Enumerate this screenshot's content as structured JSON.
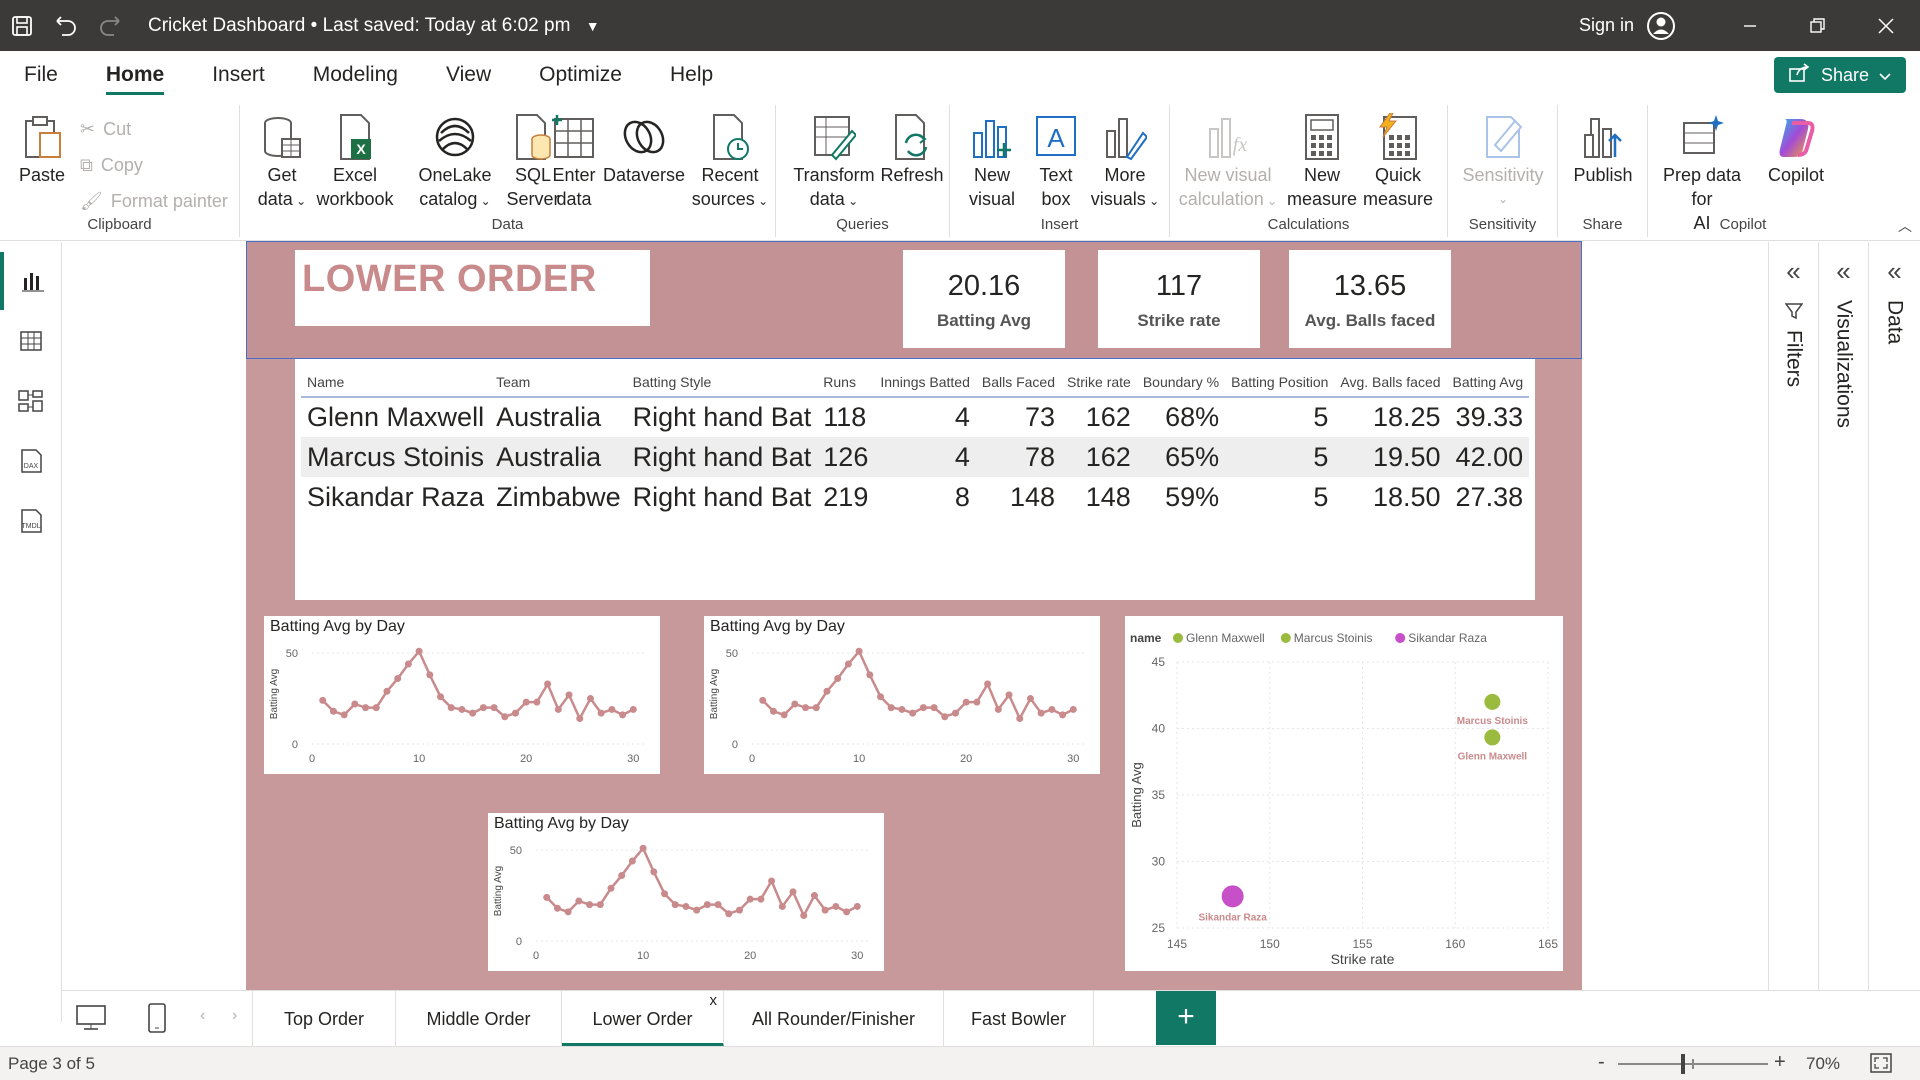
{
  "titlebar": {
    "title": "Cricket Dashboard",
    "saved": "Last saved: Today at 6:02 pm",
    "signin": "Sign in"
  },
  "menu": {
    "tabs": [
      "File",
      "Home",
      "Insert",
      "Modeling",
      "View",
      "Optimize",
      "Help"
    ],
    "active": "Home",
    "share": "Share"
  },
  "ribbon": {
    "clipboard": {
      "label": "Clipboard",
      "paste": "Paste",
      "cut": "Cut",
      "copy": "Copy",
      "format_painter": "Format painter"
    },
    "data": {
      "label": "Data",
      "get_data": [
        "Get",
        "data"
      ],
      "excel": [
        "Excel",
        "workbook"
      ],
      "onelake": [
        "OneLake",
        "catalog"
      ],
      "sql": [
        "SQL",
        "Server"
      ],
      "enter": [
        "Enter",
        "data"
      ],
      "dataverse": "Dataverse",
      "recent": [
        "Recent",
        "sources"
      ]
    },
    "queries": {
      "label": "Queries",
      "transform": [
        "Transform",
        "data"
      ],
      "refresh": "Refresh"
    },
    "insert": {
      "label": "Insert",
      "new_visual": [
        "New",
        "visual"
      ],
      "text_box": [
        "Text",
        "box"
      ],
      "more_visuals": [
        "More",
        "visuals"
      ]
    },
    "calculations": {
      "label": "Calculations",
      "new_visual_calc": [
        "New visual",
        "calculation"
      ],
      "new_measure": [
        "New",
        "measure"
      ],
      "quick_measure": [
        "Quick",
        "measure"
      ]
    },
    "sensitivity": {
      "label": "Sensitivity",
      "btn": "Sensitivity"
    },
    "share": {
      "label": "Share",
      "publish": "Publish"
    },
    "copilot": {
      "label": "Copilot",
      "prep": [
        "Prep data for",
        "AI"
      ],
      "copilot": "Copilot"
    }
  },
  "report": {
    "title": "LOWER ORDER",
    "kpis": [
      {
        "value": "20.16",
        "label": "Batting Avg"
      },
      {
        "value": "117",
        "label": "Strike rate"
      },
      {
        "value": "13.65",
        "label": "Avg. Balls faced"
      }
    ],
    "table": {
      "columns": [
        "Name",
        "Team",
        "Batting Style",
        "Runs",
        "Innings Batted",
        "Balls Faced",
        "Strike rate",
        "Boundary %",
        "Batting Position",
        "Avg. Balls faced",
        "Batting Avg"
      ],
      "rows": [
        [
          "Glenn Maxwell",
          "Australia",
          "Right hand Bat",
          "118",
          "4",
          "73",
          "162",
          "68%",
          "5",
          "18.25",
          "39.33"
        ],
        [
          "Marcus Stoinis",
          "Australia",
          "Right hand Bat",
          "126",
          "4",
          "78",
          "162",
          "65%",
          "5",
          "19.50",
          "42.00"
        ],
        [
          "Sikandar Raza",
          "Zimbabwe",
          "Right hand Bat",
          "219",
          "8",
          "148",
          "148",
          "59%",
          "5",
          "18.50",
          "27.38"
        ]
      ]
    },
    "line_chart_title": "Batting Avg by Day",
    "line_chart_ylabel": "Batting Avg",
    "scatter_legend_title": "name",
    "scatter_xlabel": "Strike rate",
    "scatter_ylabel": "Batting Avg"
  },
  "chart_data": [
    {
      "type": "line",
      "title": "Batting Avg by Day",
      "xlabel": "",
      "ylabel": "Batting Avg",
      "xlim": [
        0,
        31
      ],
      "ylim": [
        0,
        55
      ],
      "xticks": [
        0,
        10,
        20,
        30
      ],
      "yticks": [
        0,
        50
      ],
      "color": "#c98a8c",
      "x": [
        1,
        2,
        3,
        4,
        5,
        6,
        7,
        8,
        9,
        10,
        11,
        12,
        13,
        14,
        15,
        16,
        17,
        18,
        19,
        20,
        21,
        22,
        23,
        24,
        25,
        26,
        27,
        28,
        29,
        30
      ],
      "y": [
        24,
        18,
        16,
        22,
        20,
        20,
        29,
        36,
        44,
        51,
        38,
        26,
        20,
        19,
        17,
        20,
        20,
        15,
        17,
        23,
        23,
        33,
        19,
        27,
        14,
        25,
        17,
        19,
        16,
        19
      ]
    },
    {
      "type": "line",
      "title": "Batting Avg by Day",
      "xlabel": "",
      "ylabel": "Batting Avg",
      "xlim": [
        0,
        31
      ],
      "ylim": [
        0,
        55
      ],
      "xticks": [
        0,
        10,
        20,
        30
      ],
      "yticks": [
        0,
        50
      ],
      "color": "#c98a8c",
      "x": [
        1,
        2,
        3,
        4,
        5,
        6,
        7,
        8,
        9,
        10,
        11,
        12,
        13,
        14,
        15,
        16,
        17,
        18,
        19,
        20,
        21,
        22,
        23,
        24,
        25,
        26,
        27,
        28,
        29,
        30
      ],
      "y": [
        24,
        18,
        16,
        22,
        20,
        20,
        29,
        36,
        44,
        51,
        38,
        26,
        20,
        19,
        17,
        20,
        20,
        15,
        17,
        23,
        23,
        33,
        19,
        27,
        14,
        25,
        17,
        19,
        16,
        19
      ]
    },
    {
      "type": "line",
      "title": "Batting Avg by Day",
      "xlabel": "",
      "ylabel": "Batting Avg",
      "xlim": [
        0,
        31
      ],
      "ylim": [
        0,
        55
      ],
      "xticks": [
        0,
        10,
        20,
        30
      ],
      "yticks": [
        0,
        50
      ],
      "color": "#c98a8c",
      "x": [
        1,
        2,
        3,
        4,
        5,
        6,
        7,
        8,
        9,
        10,
        11,
        12,
        13,
        14,
        15,
        16,
        17,
        18,
        19,
        20,
        21,
        22,
        23,
        24,
        25,
        26,
        27,
        28,
        29,
        30
      ],
      "y": [
        24,
        18,
        16,
        22,
        20,
        20,
        29,
        36,
        44,
        51,
        38,
        26,
        20,
        19,
        17,
        20,
        20,
        15,
        17,
        23,
        23,
        33,
        19,
        27,
        14,
        25,
        17,
        19,
        16,
        19
      ]
    },
    {
      "type": "scatter",
      "title": "",
      "xlabel": "Strike rate",
      "ylabel": "Batting Avg",
      "xlim": [
        145,
        165
      ],
      "ylim": [
        25,
        45
      ],
      "xticks": [
        145,
        150,
        155,
        160,
        165
      ],
      "yticks": [
        25,
        30,
        35,
        40,
        45
      ],
      "legend_title": "name",
      "legend_position": "top-left",
      "series": [
        {
          "name": "Glenn Maxwell",
          "color": "#9bbb3f",
          "x": [
            162
          ],
          "y": [
            39.33
          ]
        },
        {
          "name": "Marcus Stoinis",
          "color": "#9bbb3f",
          "x": [
            162
          ],
          "y": [
            42.0
          ]
        },
        {
          "name": "Sikandar Raza",
          "color": "#c74fc7",
          "x": [
            148
          ],
          "y": [
            27.38
          ]
        }
      ]
    }
  ],
  "pane": {
    "filters": "Filters",
    "visualizations": "Visualizations",
    "data": "Data"
  },
  "pages": {
    "tabs": [
      "Top Order",
      "Middle Order",
      "Lower Order",
      "All Rounder/Finisher",
      "Fast Bowler"
    ],
    "active": "Lower Order",
    "close": "x",
    "add": "+"
  },
  "status": {
    "page": "Page 3 of 5",
    "zoom": "70%",
    "zoom_level": 0.7
  }
}
